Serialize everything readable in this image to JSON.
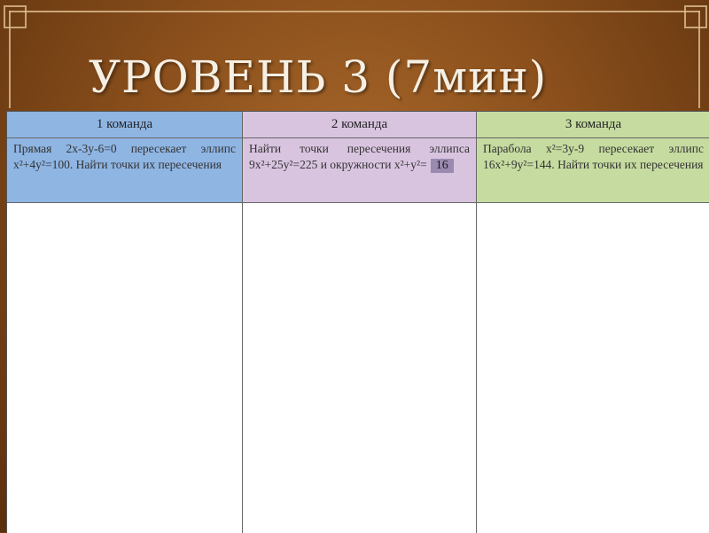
{
  "slide": {
    "title": "УРОВЕНЬ 3 (7мин)"
  },
  "table": {
    "headers": [
      "1 команда",
      "2 команда",
      "3 команда"
    ],
    "tasks": [
      "Прямая 2х-3у-6=0 пересекает эллипс х²+4у²=100. Найти точки их пересечения",
      "Найти точки пересечения эллипса 9х²+25у²=225 и окружности х²+у²=",
      "Парабола х²=3у-9 пересекает эллипс 16х²+9у²=144. Найти точки их пересечения"
    ],
    "task2_box_value": "16"
  },
  "colors": {
    "background": "#8a4f1c",
    "team1": "#8fb5e3",
    "team2": "#d9c4e0",
    "team3": "#c6dba0"
  }
}
